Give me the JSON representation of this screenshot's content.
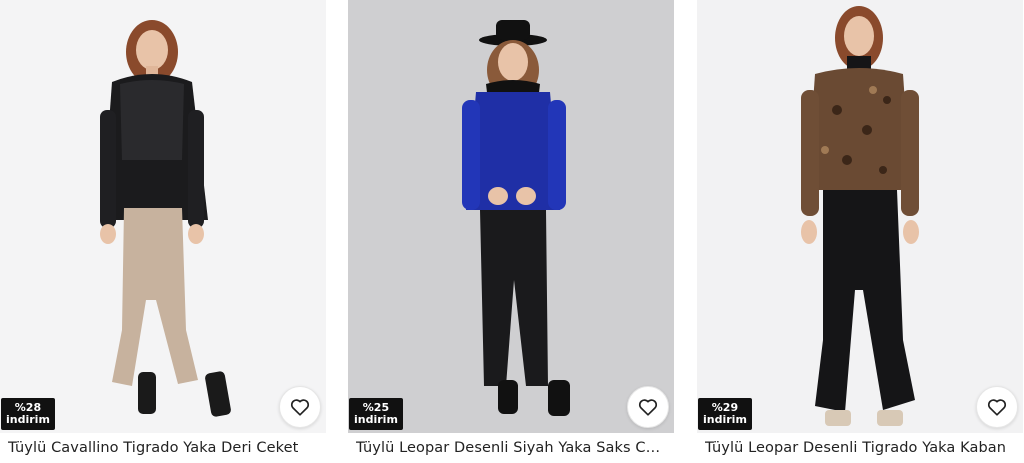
{
  "products": [
    {
      "discount_value": "%28",
      "discount_label": "indirim",
      "title": "Tüylü Cavallino Tigrado Yaka Deri Ceket",
      "photo_bg": "#f4f4f5",
      "jacket_color": "#1b1b1d",
      "pants_color": "#c7b29e"
    },
    {
      "discount_value": "%25",
      "discount_label": "indirim",
      "title": "Tüylü Leopar Desenli Siyah Yaka Saks Ceket",
      "photo_bg": "#cfcfd1",
      "jacket_color": "#1f2fa6",
      "pants_color": "#1a1a1c"
    },
    {
      "discount_value": "%29",
      "discount_label": "indirim",
      "title": "Tüylü Leopar Desenli Tigrado Yaka Kaban",
      "photo_bg": "#f2f2f3",
      "jacket_color": "#6a4a33",
      "pants_color": "#151517"
    }
  ]
}
